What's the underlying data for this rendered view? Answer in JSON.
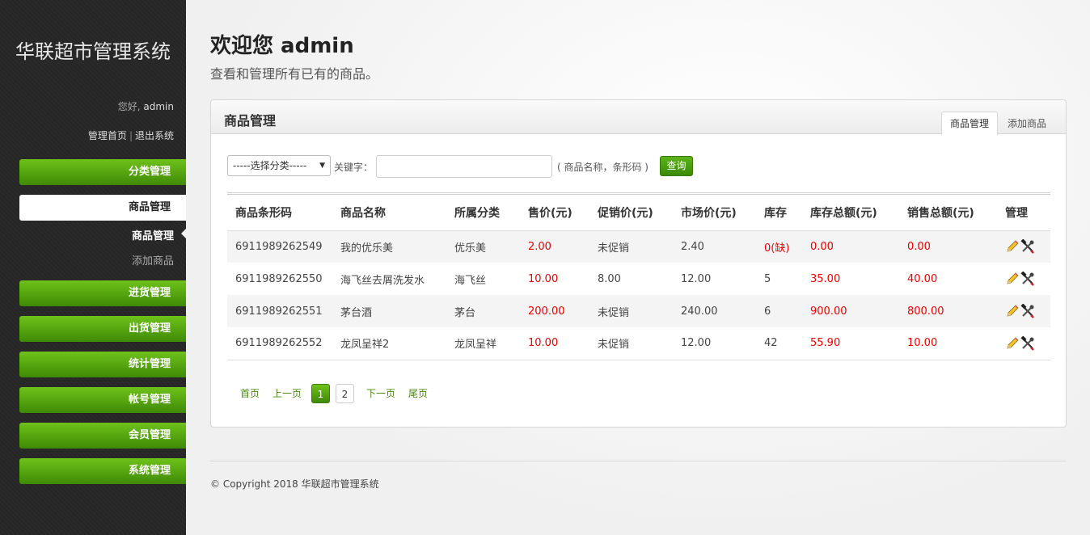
{
  "sidebar": {
    "app_title": "华联超市管理系统",
    "greeting_prefix": "您好,",
    "username": "admin",
    "home_link": "管理首页",
    "separator": "|",
    "logout_link": "退出系统",
    "items": [
      {
        "label": "分类管理"
      },
      {
        "label": "商品管理",
        "active": true
      },
      {
        "label": "进货管理"
      },
      {
        "label": "出货管理"
      },
      {
        "label": "统计管理"
      },
      {
        "label": "帐号管理"
      },
      {
        "label": "会员管理"
      },
      {
        "label": "系统管理"
      }
    ],
    "sub_items": [
      {
        "label": "商品管理",
        "current": true
      },
      {
        "label": "添加商品"
      }
    ]
  },
  "header": {
    "welcome": "欢迎您 admin",
    "subtitle": "查看和管理所有已有的商品。"
  },
  "panel": {
    "title": "商品管理",
    "tabs": [
      {
        "label": "商品管理",
        "active": true
      },
      {
        "label": "添加商品"
      }
    ]
  },
  "search": {
    "category_selected": "-----选择分类-----",
    "keyword_label": "关键字：",
    "keyword_value": "",
    "hint": "( 商品名称，条形码 )",
    "query_button": "查询"
  },
  "table": {
    "columns": [
      "商品条形码",
      "商品名称",
      "所属分类",
      "售价(元)",
      "促销价(元)",
      "市场价(元)",
      "库存",
      "库存总额(元)",
      "销售总额(元)",
      "管理"
    ],
    "rows": [
      {
        "barcode": "6911989262549",
        "name": "我的优乐美",
        "category": "优乐美",
        "price": "2.00",
        "promo": "未促销",
        "market": "2.40",
        "stock": "0(缺)",
        "stock_total": "0.00",
        "sales_total": "0.00"
      },
      {
        "barcode": "6911989262550",
        "name": "海飞丝去屑洗发水",
        "category": "海飞丝",
        "price": "10.00",
        "promo": "8.00",
        "market": "12.00",
        "stock": "5",
        "stock_total": "35.00",
        "sales_total": "40.00"
      },
      {
        "barcode": "6911989262551",
        "name": "茅台酒",
        "category": "茅台",
        "price": "200.00",
        "promo": "未促销",
        "market": "240.00",
        "stock": "6",
        "stock_total": "900.00",
        "sales_total": "800.00"
      },
      {
        "barcode": "6911989262552",
        "name": "龙凤呈祥2",
        "category": "龙凤呈祥",
        "price": "10.00",
        "promo": "未促销",
        "market": "12.00",
        "stock": "42",
        "stock_total": "55.90",
        "sales_total": "10.00"
      }
    ],
    "actions": [
      "edit-icon",
      "delete-icon"
    ]
  },
  "pager": {
    "first": "首页",
    "prev": "上一页",
    "pages": [
      "1",
      "2"
    ],
    "current_page": "1",
    "next": "下一页",
    "last": "尾页"
  },
  "footer": {
    "copyright": "© Copyright 2018 华联超市管理系统"
  },
  "colors": {
    "accent_green": "#4a9a0e",
    "alert_red": "#ee0000"
  }
}
